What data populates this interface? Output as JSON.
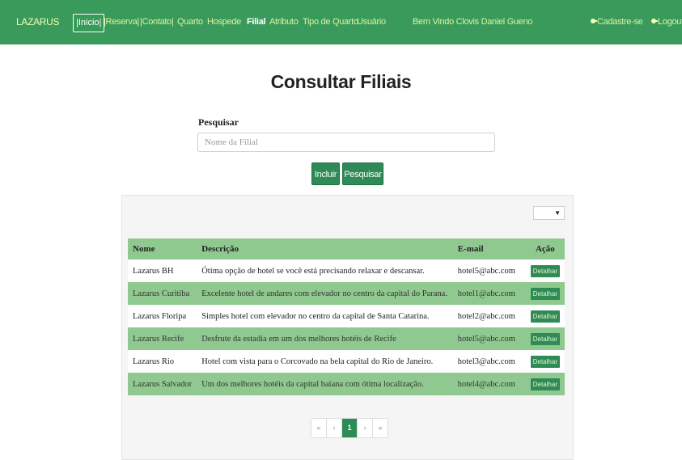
{
  "navbar": {
    "brand": "LAZARUS",
    "links": [
      {
        "label": "|Inicio|"
      },
      {
        "label": "|Reserva|"
      },
      {
        "label": "|Contato|"
      },
      {
        "label": "Quarto"
      },
      {
        "label": "Hospede"
      },
      {
        "label": "Filial"
      },
      {
        "label": "Atributo"
      },
      {
        "label": "Tipo de Quarto"
      },
      {
        "label": "Usuário"
      }
    ],
    "welcome": "Bem Vindo Clovis Daniel Gueno",
    "signup": "Cadastre-se",
    "logout": "Logout"
  },
  "page": {
    "title": "Consultar Filiais",
    "search_label": "Pesquisar",
    "search_placeholder": "Nome da Filial",
    "search_value": "",
    "btn_incluir": "Incluir",
    "btn_pesquisar": "Pesquisar"
  },
  "table": {
    "headers": [
      "Nome",
      "Descrição",
      "E-mail",
      "Ação"
    ],
    "rows": [
      {
        "nome": "Lazarus BH",
        "descricao": "Ótima opção de hotel se você está precisando relaxar e descansar.",
        "email": "hotel5@abc.com",
        "acao": "Detalhar"
      },
      {
        "nome": "Lazarus Curitiba",
        "descricao": "Excelente hotel de andares com elevador no centro da capital do Parana.",
        "email": "hotel1@abc.com",
        "acao": "Detalhar"
      },
      {
        "nome": "Lazarus Floripa",
        "descricao": "Simples hotel com elevador no centro da capital de Santa Catarina.",
        "email": "hotel2@abc.com",
        "acao": "Detalhar"
      },
      {
        "nome": "Lazarus Recife",
        "descricao": "Desfrute da estadia em um dos melhores hotéis de Recife",
        "email": "hotel5@abc.com",
        "acao": "Detalhar"
      },
      {
        "nome": "Lazarus Rio",
        "descricao": "Hotel com vista para o Corcovado na bela capital do Rio de Janeiro.",
        "email": "hotel3@abc.com",
        "acao": "Detalhar"
      },
      {
        "nome": "Lazarus Salvador",
        "descricao": "Um dos melhores hotéis da capital baiana com ótima localização.",
        "email": "hotel4@abc.com",
        "acao": "Detalhar"
      }
    ]
  },
  "pagination": {
    "first": "«",
    "prev": "‹",
    "current": "1",
    "next": "›",
    "last": "»"
  },
  "colors": {
    "navbar_bg": "#3a9a5b",
    "accent": "#2e8b57",
    "stripe": "#8fc98f"
  }
}
